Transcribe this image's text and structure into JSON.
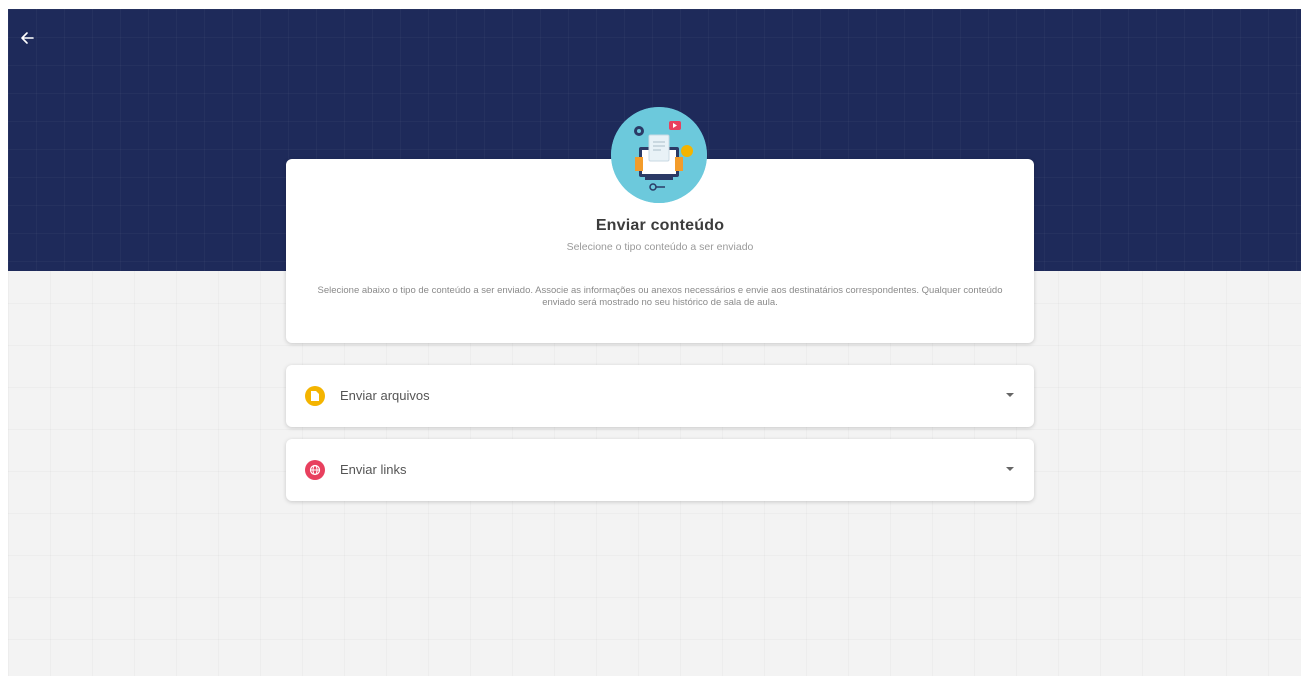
{
  "header": {
    "back_icon": "arrow-left-icon"
  },
  "hero": {
    "icon": "content-illustration-icon"
  },
  "card": {
    "title": "Enviar conteúdo",
    "subtitle": "Selecione o tipo conteúdo a ser enviado",
    "description": "Selecione abaixo o tipo de conteúdo a ser enviado. Associe as informações ou anexos necessários e envie aos destinatários correspondentes. Qualquer conteúdo enviado será mostrado no seu histórico de sala de aula."
  },
  "panels": [
    {
      "label": "Enviar arquivos",
      "icon": "file-icon",
      "color": "#f4b400"
    },
    {
      "label": "Enviar links",
      "icon": "globe-icon",
      "color": "#e8405e"
    }
  ],
  "colors": {
    "banner": "#1e2a5a",
    "background": "#f3f3f3",
    "hero_circle": "#6cc9dc"
  }
}
